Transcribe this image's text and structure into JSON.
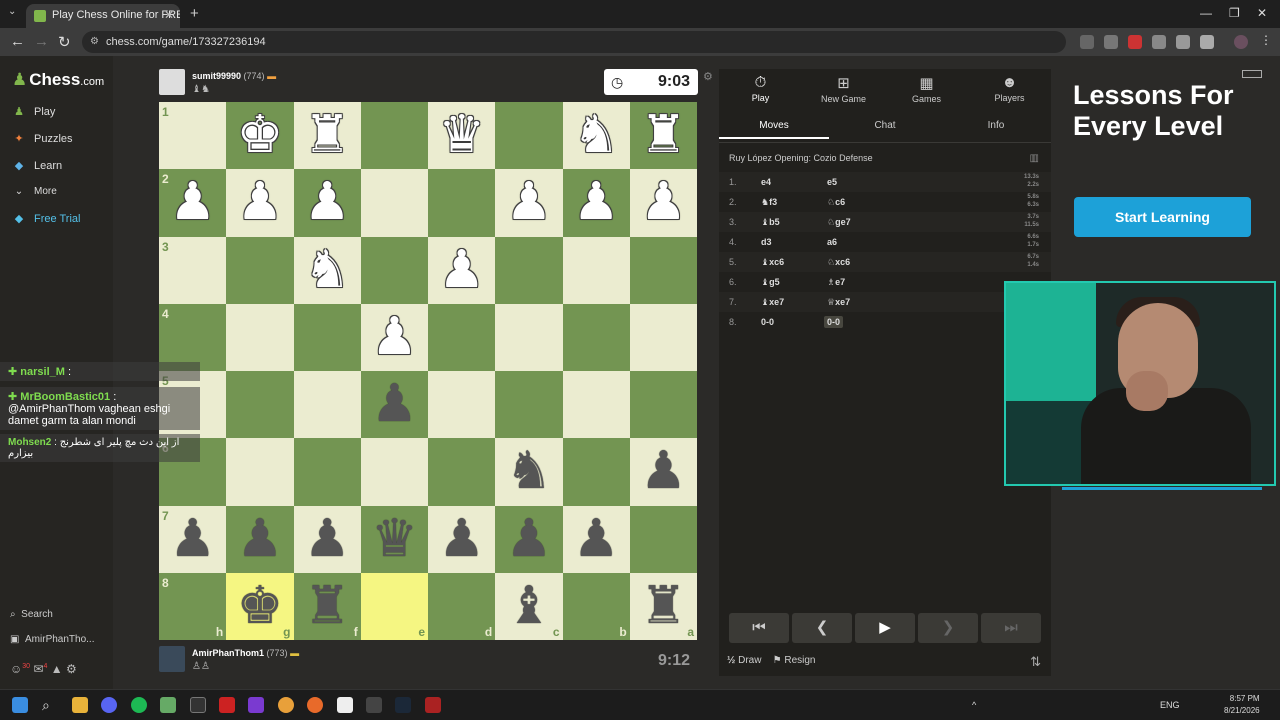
{
  "browser": {
    "tab_title": "Play Chess Online for FREE",
    "url": "chess.com/game/173327236194"
  },
  "leftnav": {
    "logo": "Chess",
    "logo_suffix": ".com",
    "items": [
      {
        "label": "Play",
        "icon": "play-icon"
      },
      {
        "label": "Puzzles",
        "icon": "puzzle-icon"
      },
      {
        "label": "Learn",
        "icon": "learn-icon"
      },
      {
        "label": "More",
        "icon": "chevron-down-icon"
      },
      {
        "label": "Free Trial",
        "icon": "diamond-icon"
      }
    ],
    "search_label": "Search",
    "user_label": "AmirPhanTho...",
    "badge_counts": [
      "30",
      "4"
    ]
  },
  "top_player": {
    "name": "sumit99990",
    "rating": "(774)",
    "clock": "9:03"
  },
  "bottom_player": {
    "name": "AmirPhanThom1",
    "rating": "(773)",
    "clock": "9:12"
  },
  "board": {
    "ranks": [
      "1",
      "2",
      "3",
      "4",
      "5",
      "6",
      "7",
      "8"
    ],
    "files": [
      "h",
      "g",
      "f",
      "e",
      "d",
      "c",
      "b",
      "a"
    ],
    "highlight_squares": [
      "g8",
      "e8"
    ],
    "pieces": [
      {
        "sq": "g1",
        "glyph": "♚",
        "color": "w"
      },
      {
        "sq": "f1",
        "glyph": "♜",
        "color": "w"
      },
      {
        "sq": "d1",
        "glyph": "♛",
        "color": "w"
      },
      {
        "sq": "b1",
        "glyph": "♞",
        "color": "w"
      },
      {
        "sq": "a1",
        "glyph": "♜",
        "color": "w"
      },
      {
        "sq": "h2",
        "glyph": "♟",
        "color": "w"
      },
      {
        "sq": "g2",
        "glyph": "♟",
        "color": "w"
      },
      {
        "sq": "f2",
        "glyph": "♟",
        "color": "w"
      },
      {
        "sq": "c2",
        "glyph": "♟",
        "color": "w"
      },
      {
        "sq": "b2",
        "glyph": "♟",
        "color": "w"
      },
      {
        "sq": "a2",
        "glyph": "♟",
        "color": "w"
      },
      {
        "sq": "f3",
        "glyph": "♞",
        "color": "w"
      },
      {
        "sq": "d3",
        "glyph": "♟",
        "color": "w"
      },
      {
        "sq": "e4",
        "glyph": "♟",
        "color": "w"
      },
      {
        "sq": "e5",
        "glyph": "♟",
        "color": "b"
      },
      {
        "sq": "c6",
        "glyph": "♞",
        "color": "b"
      },
      {
        "sq": "a6",
        "glyph": "♟",
        "color": "b"
      },
      {
        "sq": "h7",
        "glyph": "♟",
        "color": "b"
      },
      {
        "sq": "g7",
        "glyph": "♟",
        "color": "b"
      },
      {
        "sq": "f7",
        "glyph": "♟",
        "color": "b"
      },
      {
        "sq": "e7",
        "glyph": "♛",
        "color": "b"
      },
      {
        "sq": "d7",
        "glyph": "♟",
        "color": "b"
      },
      {
        "sq": "c7",
        "glyph": "♟",
        "color": "b"
      },
      {
        "sq": "b7",
        "glyph": "♟",
        "color": "b"
      },
      {
        "sq": "g8",
        "glyph": "♚",
        "color": "b"
      },
      {
        "sq": "f8",
        "glyph": "♜",
        "color": "b"
      },
      {
        "sq": "c8",
        "glyph": "♝",
        "color": "b"
      },
      {
        "sq": "a8",
        "glyph": "♜",
        "color": "b"
      }
    ]
  },
  "chat": [
    {
      "user": "narsil_M",
      "text": ""
    },
    {
      "user": "MrBoomBastic01",
      "text": "@AmirPhanThom vaghean eshgi damet garm ta alan mondi"
    },
    {
      "user": "Mohsen2",
      "text": "از این دث مچ پلیر ای شطرنج بیزارم"
    }
  ],
  "panel": {
    "tabs": [
      {
        "label": "Play",
        "icon": "stopwatch-icon"
      },
      {
        "label": "New Game",
        "icon": "plus-icon"
      },
      {
        "label": "Games",
        "icon": "board-icon"
      },
      {
        "label": "Players",
        "icon": "players-icon"
      }
    ],
    "subtabs": [
      "Moves",
      "Chat",
      "Info"
    ],
    "opening": "Ruy López Opening: Cozio Defense",
    "moves": [
      {
        "n": "1.",
        "w": "e4",
        "b": "e5",
        "t": [
          "13.3s",
          "2.2s"
        ]
      },
      {
        "n": "2.",
        "w": "♞f3",
        "b": "♘c6",
        "t": [
          "5.8s",
          "6.3s"
        ]
      },
      {
        "n": "3.",
        "w": "♝b5",
        "b": "♘ge7",
        "t": [
          "3.7s",
          "11.5s"
        ]
      },
      {
        "n": "4.",
        "w": "d3",
        "b": "a6",
        "t": [
          "6.6s",
          "1.7s"
        ]
      },
      {
        "n": "5.",
        "w": "♝xc6",
        "b": "♘xc6",
        "t": [
          "6.7s",
          "1.4s"
        ]
      },
      {
        "n": "6.",
        "w": "♝g5",
        "b": "♗e7",
        "t": [
          "",
          ""
        ]
      },
      {
        "n": "7.",
        "w": "♝xe7",
        "b": "♕xe7",
        "t": [
          "",
          ""
        ]
      },
      {
        "n": "8.",
        "w": "0-0",
        "b": "0-0",
        "t": [
          "",
          ""
        ]
      }
    ],
    "draw_label": "Draw",
    "resign_label": "Resign"
  },
  "ad": {
    "title": "Lessons For Every Level",
    "button": "Start Learning"
  },
  "taskbar": {
    "lang": "ENG",
    "time": "8:57 PM",
    "date": "8/21/2026"
  }
}
